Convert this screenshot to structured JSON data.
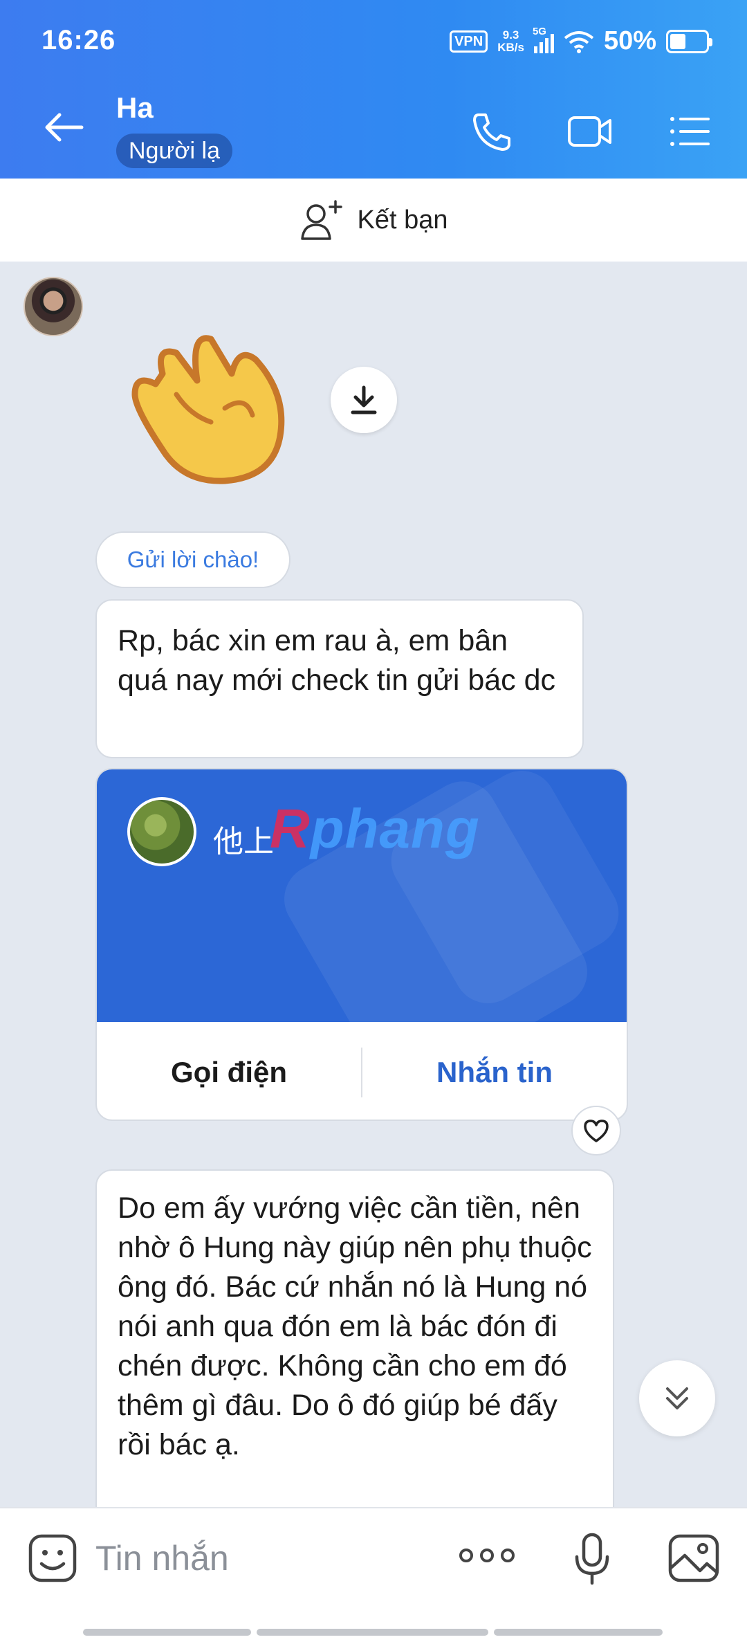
{
  "status_bar": {
    "time": "16:26",
    "vpn": "VPN",
    "speed_value": "9.3",
    "speed_unit": "KB/s",
    "network": "5G",
    "battery": "50%",
    "battery_level": 0.5
  },
  "header": {
    "contact_name": "Ha",
    "contact_tag": "Người lạ",
    "icons": [
      "back-arrow-icon",
      "phone-icon",
      "video-icon",
      "menu-list-icon"
    ]
  },
  "add_friend": {
    "label": "Kết bạn",
    "icon": "add-user-icon"
  },
  "conversation": {
    "hello_chip": "Gửi lời chào!",
    "message1": "Rp, bác xin em rau à, em bân quá nay mới check tin gửi bác dc",
    "contact_card": {
      "name": "他上",
      "watermark": [
        "R",
        "phang"
      ],
      "call_label": "Gọi điện",
      "message_label": "Nhắn tin"
    },
    "message2": "Do em ấy vướng việc cần tiền, nên nhờ ô Hung này giúp nên phụ thuộc ông đó. Bác cứ nhắn nó là Hung nó nói anh qua đón em là bác đón đi chén được. Không cần cho em đó thêm gì đâu. Do ô đó giúp bé đấy rồi bác ạ."
  },
  "input_bar": {
    "placeholder": "Tin nhắn",
    "icons": [
      "sticker-icon",
      "more-icon",
      "microphone-icon",
      "image-icon"
    ]
  },
  "colors": {
    "header_gradient_start": "#3d7cf0",
    "header_gradient_end": "#3aa2f5",
    "card_blue": "#2c67d6",
    "link_blue": "#2a63cc",
    "chat_background": "#e3e8f0"
  }
}
